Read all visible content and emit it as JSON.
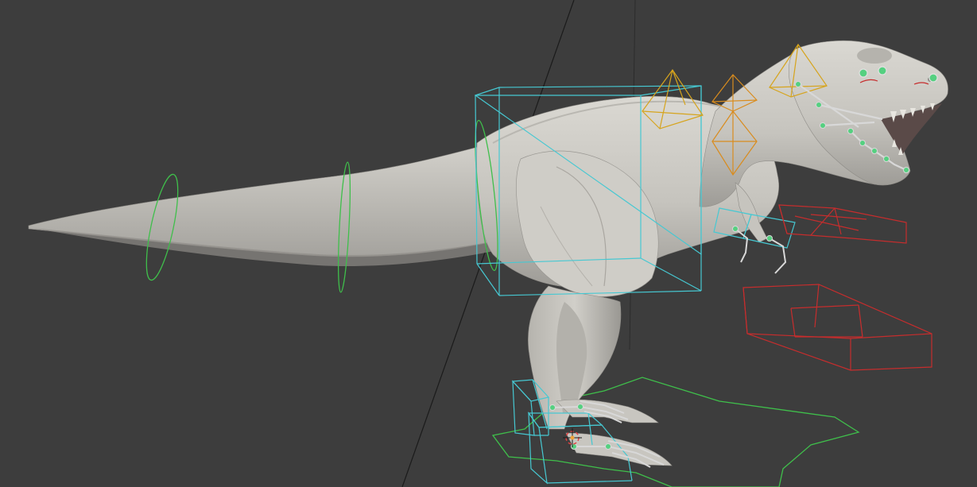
{
  "viewport": {
    "background_color": "#3d3d3d",
    "grid_line_color": "#1b1b1b"
  },
  "model": {
    "name": "trex-mesh",
    "body_color": "#c8c6c0",
    "shade_color": "#a9a6a0",
    "dark_color": "#8c8a85"
  },
  "rig": {
    "control_cyan": "#46c8d2",
    "control_green": "#3fbf4b",
    "control_yellow": "#d6a41d",
    "control_orange": "#d98c1e",
    "control_red": "#c62d2d",
    "bone_color": "#d8d8d8",
    "joint_color": "#55d080"
  },
  "gizmo": {
    "name": "3d-cursor-icon"
  }
}
